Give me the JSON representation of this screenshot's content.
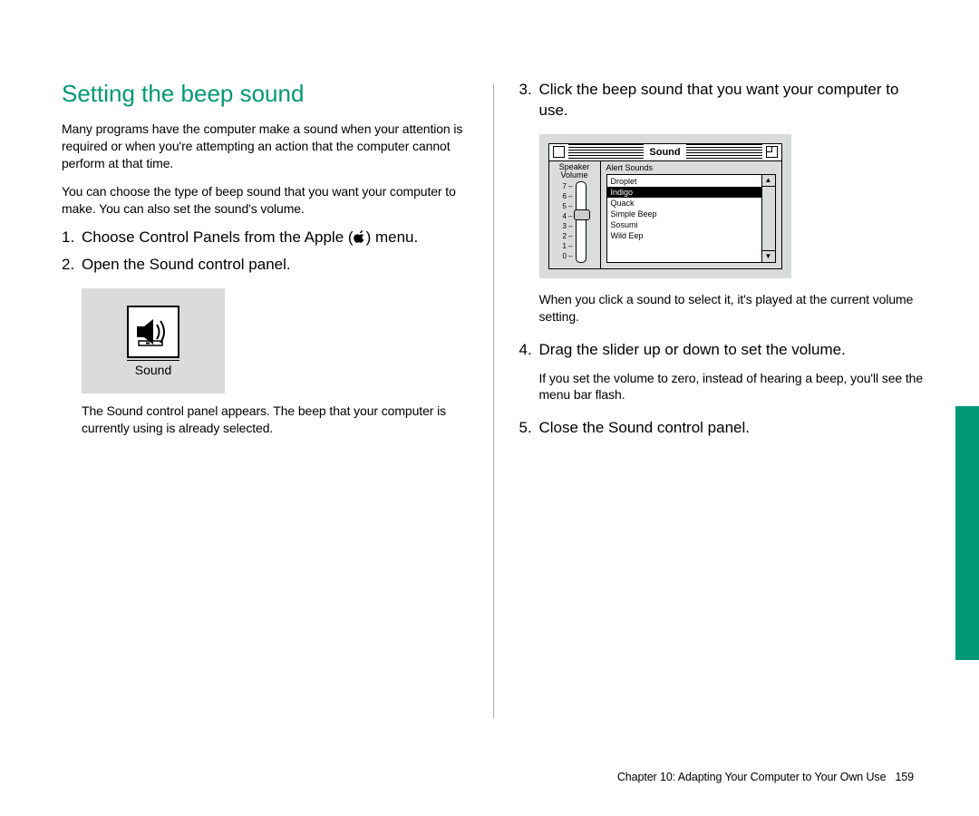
{
  "title": "Setting the beep sound",
  "intro1": "Many programs have the computer make a sound when your attention is required or when you're attempting an action that the computer cannot perform at that time.",
  "intro2": "You can choose the type of beep sound that you want your computer to make. You can also set the sound's volume.",
  "steps": {
    "s1_pre": "Choose Control Panels from the Apple (",
    "s1_post": ") menu.",
    "s2": "Open the Sound control panel.",
    "s3": "Click the beep sound that you want your computer to use.",
    "s4": "Drag the slider up or down to set the volume.",
    "s5": "Close the Sound control panel."
  },
  "notes": {
    "after2": "The Sound control panel appears. The beep that your computer is currently using is already selected.",
    "after3": "When you click a sound to select it, it's played at the current volume setting.",
    "after4": "If you set the volume to zero, instead of hearing a beep, you'll see the menu bar flash."
  },
  "sound_icon_label": "Sound",
  "panel": {
    "title": "Sound",
    "vol_label1": "Speaker",
    "vol_label2": "Volume",
    "ticks": [
      "7 –",
      "6 –",
      "5 –",
      "4 –",
      "3 –",
      "2 –",
      "1 –",
      "0 –"
    ],
    "alerts_header": "Alert Sounds",
    "alerts": [
      "Droplet",
      "Indigo",
      "Quack",
      "Simple Beep",
      "Sosumi",
      "Wild Eep"
    ],
    "selected_index": 1
  },
  "footer": {
    "chapter": "Chapter 10:  Adapting Your Computer to Your Own Use",
    "page": "159"
  }
}
